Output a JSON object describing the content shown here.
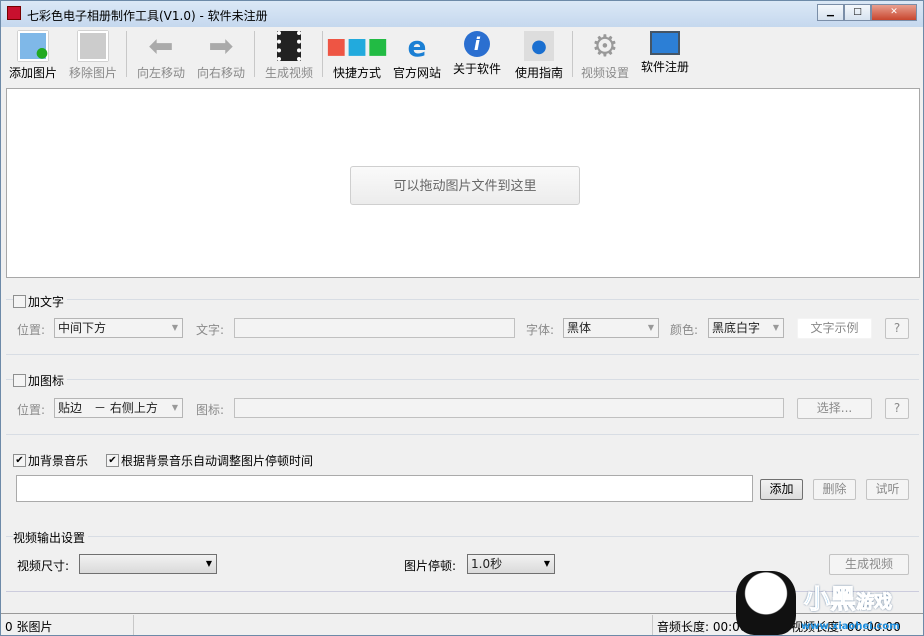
{
  "window": {
    "title": "七彩色电子相册制作工具(V1.0) - 软件未注册",
    "min": "▁",
    "max": "□",
    "close": "✕"
  },
  "toolbar": [
    {
      "label": "添加图片",
      "icon": "add-image-icon",
      "enabled": true
    },
    {
      "label": "移除图片",
      "icon": "remove-image-icon",
      "enabled": false
    },
    {
      "label": "向左移动",
      "icon": "arrow-left-icon",
      "enabled": false
    },
    {
      "label": "向右移动",
      "icon": "arrow-right-icon",
      "enabled": false
    },
    {
      "label": "生成视频",
      "icon": "film-icon",
      "enabled": false
    },
    {
      "label": "快捷方式",
      "icon": "cubes-icon",
      "enabled": true
    },
    {
      "label": "官方网站",
      "icon": "ie-icon",
      "enabled": true
    },
    {
      "label": "关于软件",
      "icon": "info-icon",
      "enabled": true
    },
    {
      "label": "使用指南",
      "icon": "http-globe-icon",
      "enabled": true
    },
    {
      "label": "视频设置",
      "icon": "gear-icon",
      "enabled": false
    },
    {
      "label": "软件注册",
      "icon": "monitor-icon",
      "enabled": true
    }
  ],
  "drop": {
    "message": "可以拖动图片文件到这里"
  },
  "text_group": {
    "title": "加文字",
    "checked": false,
    "position_label": "位置:",
    "position": "中间下方",
    "text_label": "文字:",
    "text": "",
    "font_label": "字体:",
    "font": "黑体",
    "color_label": "颜色:",
    "color": "黑底白字",
    "sample": "文字示例",
    "help": "?"
  },
  "icon_group": {
    "title": "加图标",
    "checked": false,
    "position_label": "位置:",
    "position": "贴边　－ 右侧上方",
    "icon_label": "图标:",
    "icon": "",
    "choose": "选择...",
    "help": "?"
  },
  "music_group": {
    "title": "加背景音乐",
    "checked": true,
    "auto_label": "根据背景音乐自动调整图片停顿时间",
    "auto_checked": true,
    "file": "",
    "add": "添加",
    "delete": "删除",
    "listen": "试听"
  },
  "output_group": {
    "title": "视频输出设置",
    "size_label": "视频尺寸:",
    "size": "",
    "pause_label": "图片停顿:",
    "pause": "1.0秒",
    "generate": "生成视频"
  },
  "status": {
    "count": "0 张图片",
    "audio_len": "音频长度: 00:00:00",
    "video_len": "视频长度: 00:00:00"
  },
  "watermark": {
    "text": "小黑游戏",
    "url": "www.xiaohei.com"
  }
}
